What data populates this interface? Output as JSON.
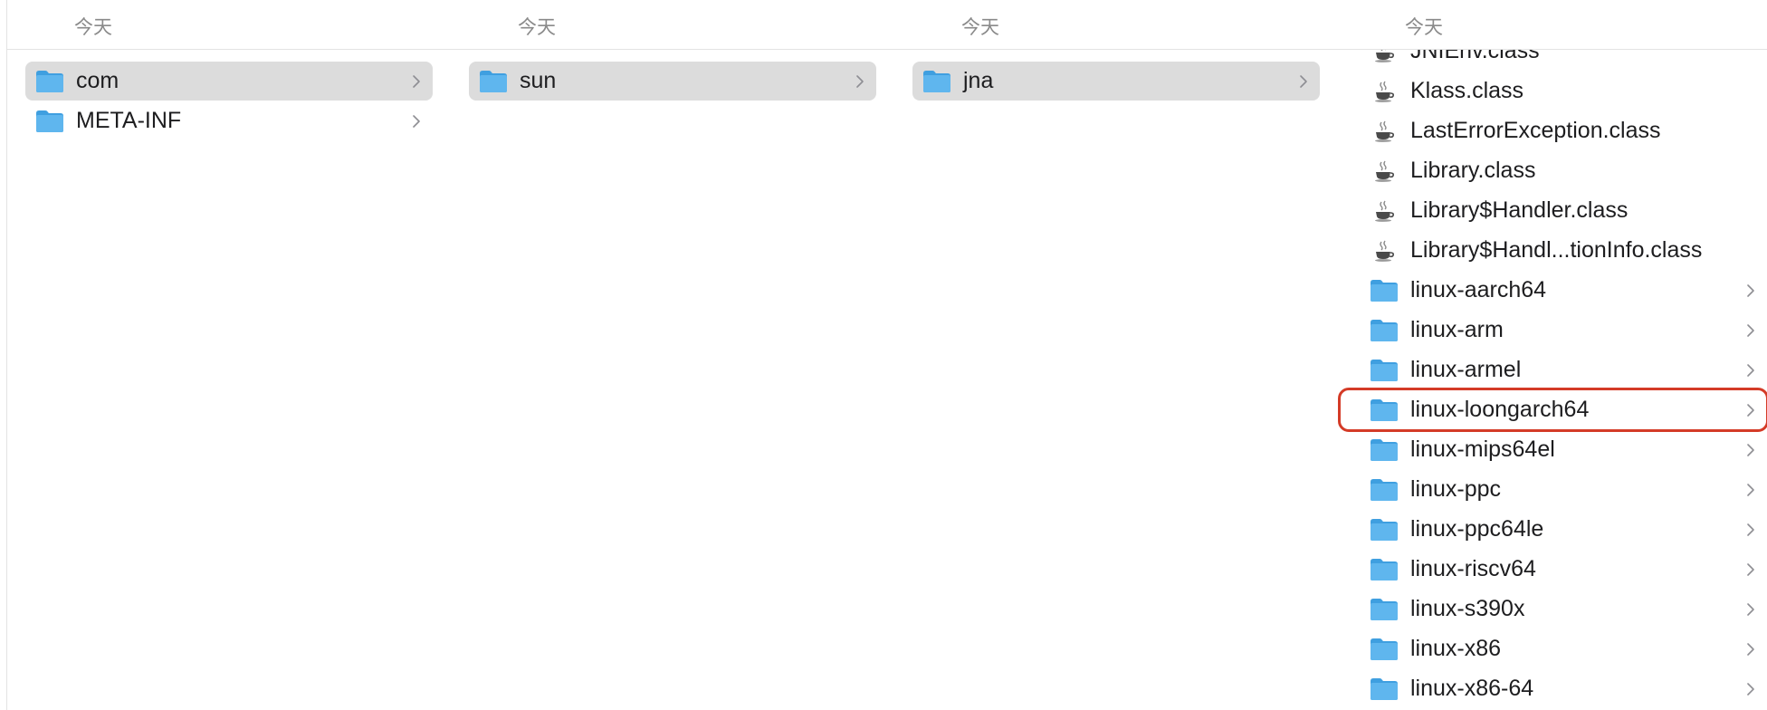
{
  "columns": [
    {
      "header": "今天",
      "items": [
        {
          "name": "com",
          "type": "folder",
          "selected": true
        },
        {
          "name": "META-INF",
          "type": "folder",
          "selected": false
        }
      ]
    },
    {
      "header": "今天",
      "items": [
        {
          "name": "sun",
          "type": "folder",
          "selected": true
        }
      ]
    },
    {
      "header": "今天",
      "items": [
        {
          "name": "jna",
          "type": "folder",
          "selected": true
        }
      ]
    },
    {
      "header": "今天",
      "items": [
        {
          "name": "JNIEnv.class",
          "type": "class"
        },
        {
          "name": "Klass.class",
          "type": "class"
        },
        {
          "name": "LastErrorException.class",
          "type": "class"
        },
        {
          "name": "Library.class",
          "type": "class"
        },
        {
          "name": "Library$Handler.class",
          "type": "class"
        },
        {
          "name": "Library$Handl...tionInfo.class",
          "type": "class"
        },
        {
          "name": "linux-aarch64",
          "type": "folder"
        },
        {
          "name": "linux-arm",
          "type": "folder"
        },
        {
          "name": "linux-armel",
          "type": "folder"
        },
        {
          "name": "linux-loongarch64",
          "type": "folder",
          "highlighted": true
        },
        {
          "name": "linux-mips64el",
          "type": "folder"
        },
        {
          "name": "linux-ppc",
          "type": "folder"
        },
        {
          "name": "linux-ppc64le",
          "type": "folder"
        },
        {
          "name": "linux-riscv64",
          "type": "folder"
        },
        {
          "name": "linux-s390x",
          "type": "folder"
        },
        {
          "name": "linux-x86",
          "type": "folder"
        },
        {
          "name": "linux-x86-64",
          "type": "folder"
        }
      ]
    }
  ],
  "colors": {
    "folder": "#5fb6ee",
    "selection": "#dcdcdc",
    "highlight": "#d43b27"
  }
}
